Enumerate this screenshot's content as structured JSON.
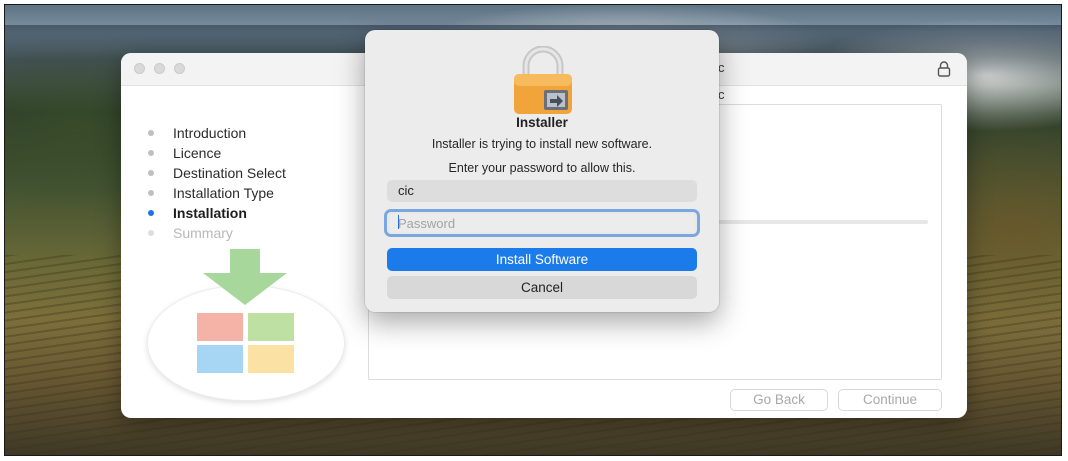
{
  "installer": {
    "title_fragment": "c",
    "subtitle_fragment": "c",
    "steps": [
      {
        "label": "Introduction",
        "state": "done"
      },
      {
        "label": "Licence",
        "state": "done"
      },
      {
        "label": "Destination Select",
        "state": "done"
      },
      {
        "label": "Installation Type",
        "state": "done"
      },
      {
        "label": "Installation",
        "state": "active"
      },
      {
        "label": "Summary",
        "state": "pending"
      }
    ],
    "go_back_label": "Go Back",
    "continue_label": "Continue"
  },
  "auth_dialog": {
    "title": "Installer",
    "message": "Installer is trying to install new software.",
    "prompt": "Enter your password to allow this.",
    "username_value": "cic",
    "password_placeholder": "Password",
    "install_label": "Install Software",
    "cancel_label": "Cancel"
  },
  "colors": {
    "accent": "#1c7bea",
    "active_step_dot": "#1a73e8",
    "logo_tiles": [
      "#f4b3a6",
      "#bfe0a3",
      "#a6d6f4",
      "#fbe1a3"
    ]
  },
  "icons": {
    "titlebar_lock": "lock-icon",
    "dialog": "padlock-icon",
    "product_logo": "download-arrow-icon"
  }
}
